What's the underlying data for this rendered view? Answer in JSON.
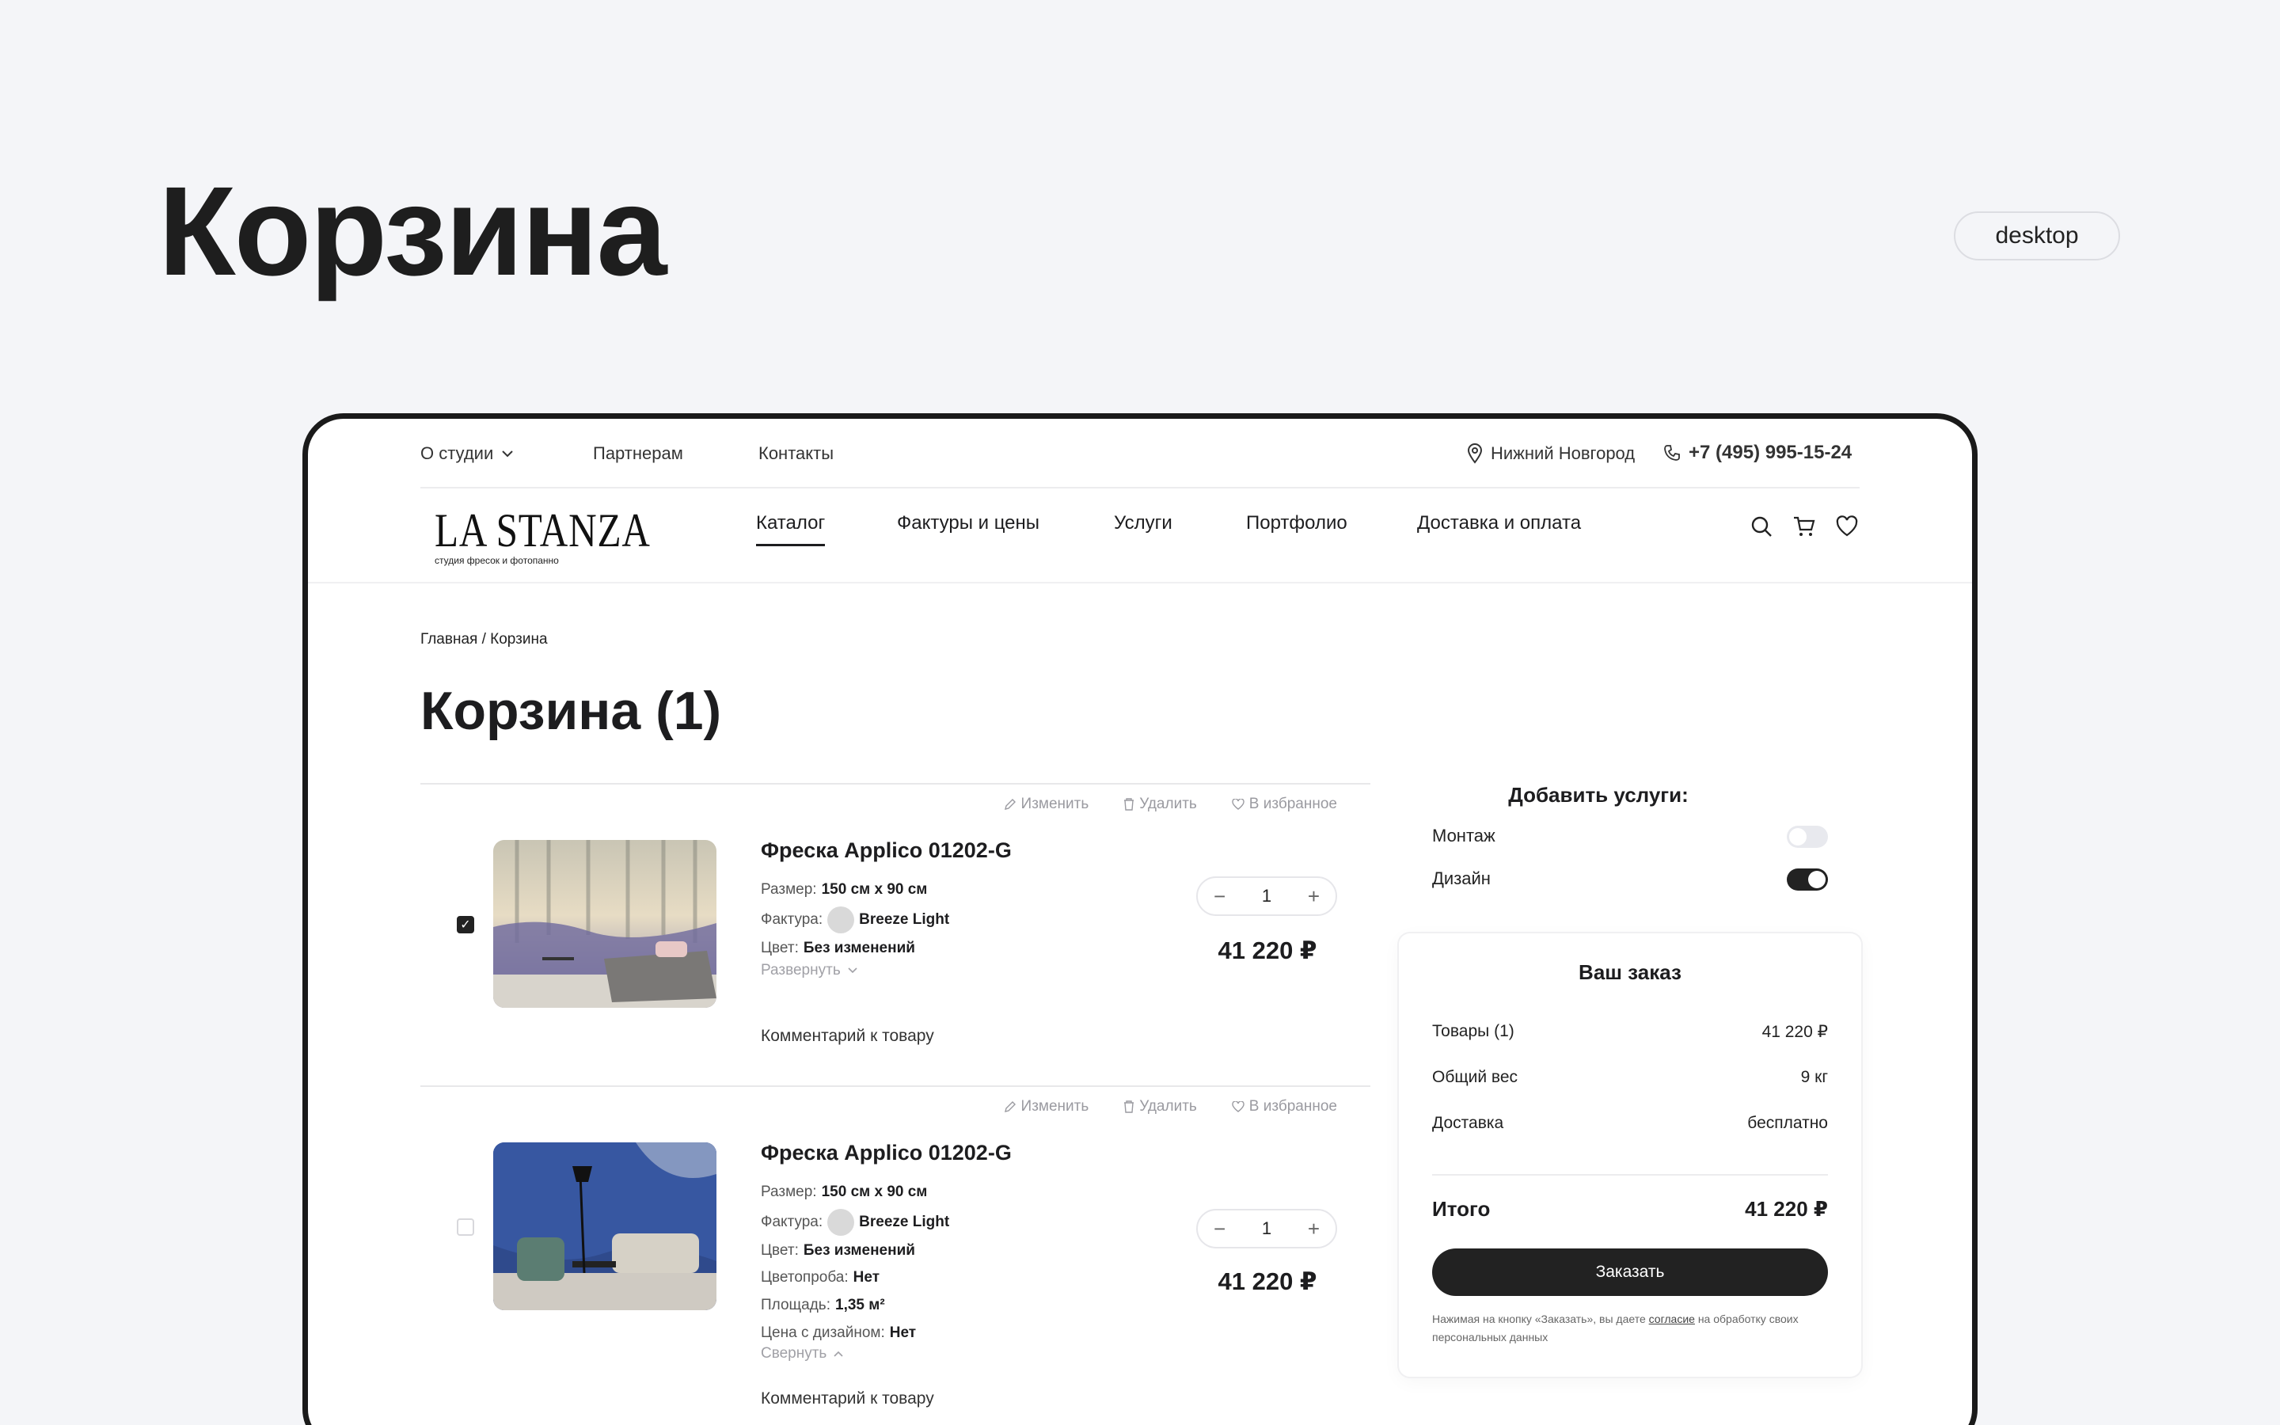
{
  "presentation": {
    "title": "Корзина",
    "badge": "desktop"
  },
  "topbar": {
    "about": "О студии",
    "partners": "Партнерам",
    "contacts": "Контакты",
    "city": "Нижний Новгород",
    "phone": "+7 (495) 995-15-24"
  },
  "logo": {
    "name": "LA STANZA",
    "tagline": "студия фресок и фотопанно"
  },
  "nav": {
    "items": [
      {
        "label": "Каталог",
        "active": true
      },
      {
        "label": "Фактуры и цены"
      },
      {
        "label": "Услуги"
      },
      {
        "label": "Портфолио"
      },
      {
        "label": "Доставка и оплата"
      }
    ],
    "icons": [
      "search-icon",
      "cart-icon",
      "heart-icon"
    ]
  },
  "breadcrumb": "Главная / Корзина",
  "page_title": "Корзина (1)",
  "item_actions": {
    "edit": "Изменить",
    "delete": "Удалить",
    "favorite": "В избранное"
  },
  "items": [
    {
      "name": "Фреска Applico 01202-G",
      "checked": true,
      "size_label": "Размер:",
      "size": "150 см х 90 см",
      "texture_label": "Фактура:",
      "texture": "Breeze Light",
      "color_label": "Цвет:",
      "color": "Без изменений",
      "toggle": "Развернуть",
      "comment": "Комментарий к товару",
      "qty": "1",
      "price": "41 220 ₽"
    },
    {
      "name": "Фреска Applico 01202-G",
      "checked": false,
      "size_label": "Размер:",
      "size": "150 см х 90 см",
      "texture_label": "Фактура:",
      "texture": "Breeze Light",
      "color_label": "Цвет:",
      "color": "Без изменений",
      "proof_label": "Цветопроба:",
      "proof": "Нет",
      "area_label": "Площадь:",
      "area": "1,35 м²",
      "design_label": "Цена с дизайном:",
      "design": "Нет",
      "toggle": "Свернуть",
      "comment": "Комментарий к товару",
      "qty": "1",
      "price": "41 220 ₽"
    }
  ],
  "services": {
    "title": "Добавить услуги:",
    "mounting": {
      "label": "Монтаж",
      "on": false
    },
    "design": {
      "label": "Дизайн",
      "on": true
    }
  },
  "order": {
    "title": "Ваш заказ",
    "goods_label": "Товары (1)",
    "goods_value": "41 220 ₽",
    "weight_label": "Общий вес",
    "weight_value": "9 кг",
    "delivery_label": "Доставка",
    "delivery_value": "бесплатно",
    "total_label": "Итого",
    "total_value": "41 220 ₽",
    "button": "Заказать",
    "note_before": "Нажимая на кнопку «Заказать», вы даете ",
    "note_link": "согласие",
    "note_after": " на обработку своих персональных данных"
  },
  "colors": {
    "accent": "#222222",
    "muted": "#9a9aa0",
    "background": "#f4f5f8"
  }
}
